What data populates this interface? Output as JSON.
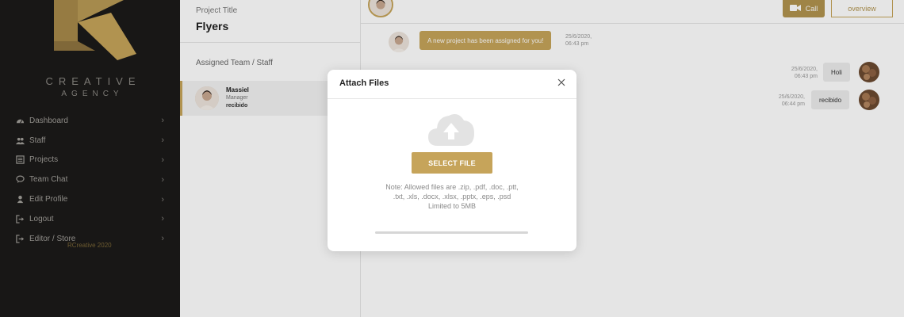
{
  "sidebar": {
    "brand_line1": "CREATIVE",
    "brand_line2": "AGENCY",
    "items": [
      {
        "label": "Dashboard",
        "icon": "dashboard-icon"
      },
      {
        "label": "Staff",
        "icon": "users-icon"
      },
      {
        "label": "Projects",
        "icon": "projects-icon"
      },
      {
        "label": "Team Chat",
        "icon": "chat-icon"
      },
      {
        "label": "Edit Profile",
        "icon": "user-icon"
      },
      {
        "label": "Logout",
        "icon": "logout-icon"
      },
      {
        "label": "Editor / Store",
        "icon": "store-icon"
      }
    ],
    "copyright": "RCreative 2020"
  },
  "project": {
    "label": "Project Title",
    "title": "Flyers",
    "team_label": "Assigned Team / Staff",
    "member": {
      "name": "Massiel",
      "role": "Manager",
      "last_message": "recibido"
    }
  },
  "chat": {
    "call_label": "Call",
    "overview_label": "overview",
    "messages": [
      {
        "direction": "in",
        "text": "A new project has been assigned for you!",
        "date": "25/6/2020,",
        "time": "06:43 pm"
      },
      {
        "direction": "out",
        "text": "Holi",
        "date": "25/6/2020,",
        "time": "06:43 pm"
      },
      {
        "direction": "out",
        "text": "recibido",
        "date": "25/6/2020,",
        "time": "06:44 pm"
      }
    ]
  },
  "modal": {
    "title": "Attach Files",
    "select_label": "SELECT FILE",
    "note_line1": "Note: Allowed files are .zip, .pdf, .doc, .ptt,",
    "note_line2": ".txt, .xls, .docx, .xlsx, .pptx, .eps, .psd",
    "note_line3": "Limited to 5MB",
    "upload_progress": 0
  },
  "colors": {
    "accent": "#c6a45a",
    "sidebar_bg": "#1b1a19"
  }
}
